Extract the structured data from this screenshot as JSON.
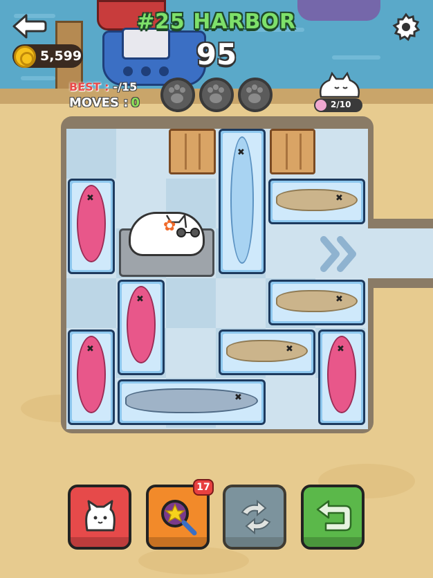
{
  "level": {
    "title": "#25 HARBOR"
  },
  "score": "95",
  "coins": "5,599",
  "stats": {
    "best_label": "BEST :",
    "best_value": "-/15",
    "moves_label": "MOVES :",
    "moves_value": "0"
  },
  "cats_collected": "2/10",
  "hint_count": "17",
  "icons": {
    "back": "back-arrow-icon",
    "settings": "gear-icon",
    "coin": "coin-icon",
    "paw": "paw-icon",
    "cat": "cat-face-icon",
    "hint": "magnifier-star-icon",
    "shuffle": "shuffle-icon",
    "undo": "undo-icon",
    "exit": "double-chevron-right-icon"
  },
  "colors": {
    "title_green": "#7ee06a",
    "best_red": "#e84a4a",
    "moves_green": "#8ee05a",
    "cat_button": "#e64a4a",
    "hint_button": "#f28a2a",
    "shuffle_button": "#6a8aa0",
    "undo_button": "#5bb84a"
  }
}
